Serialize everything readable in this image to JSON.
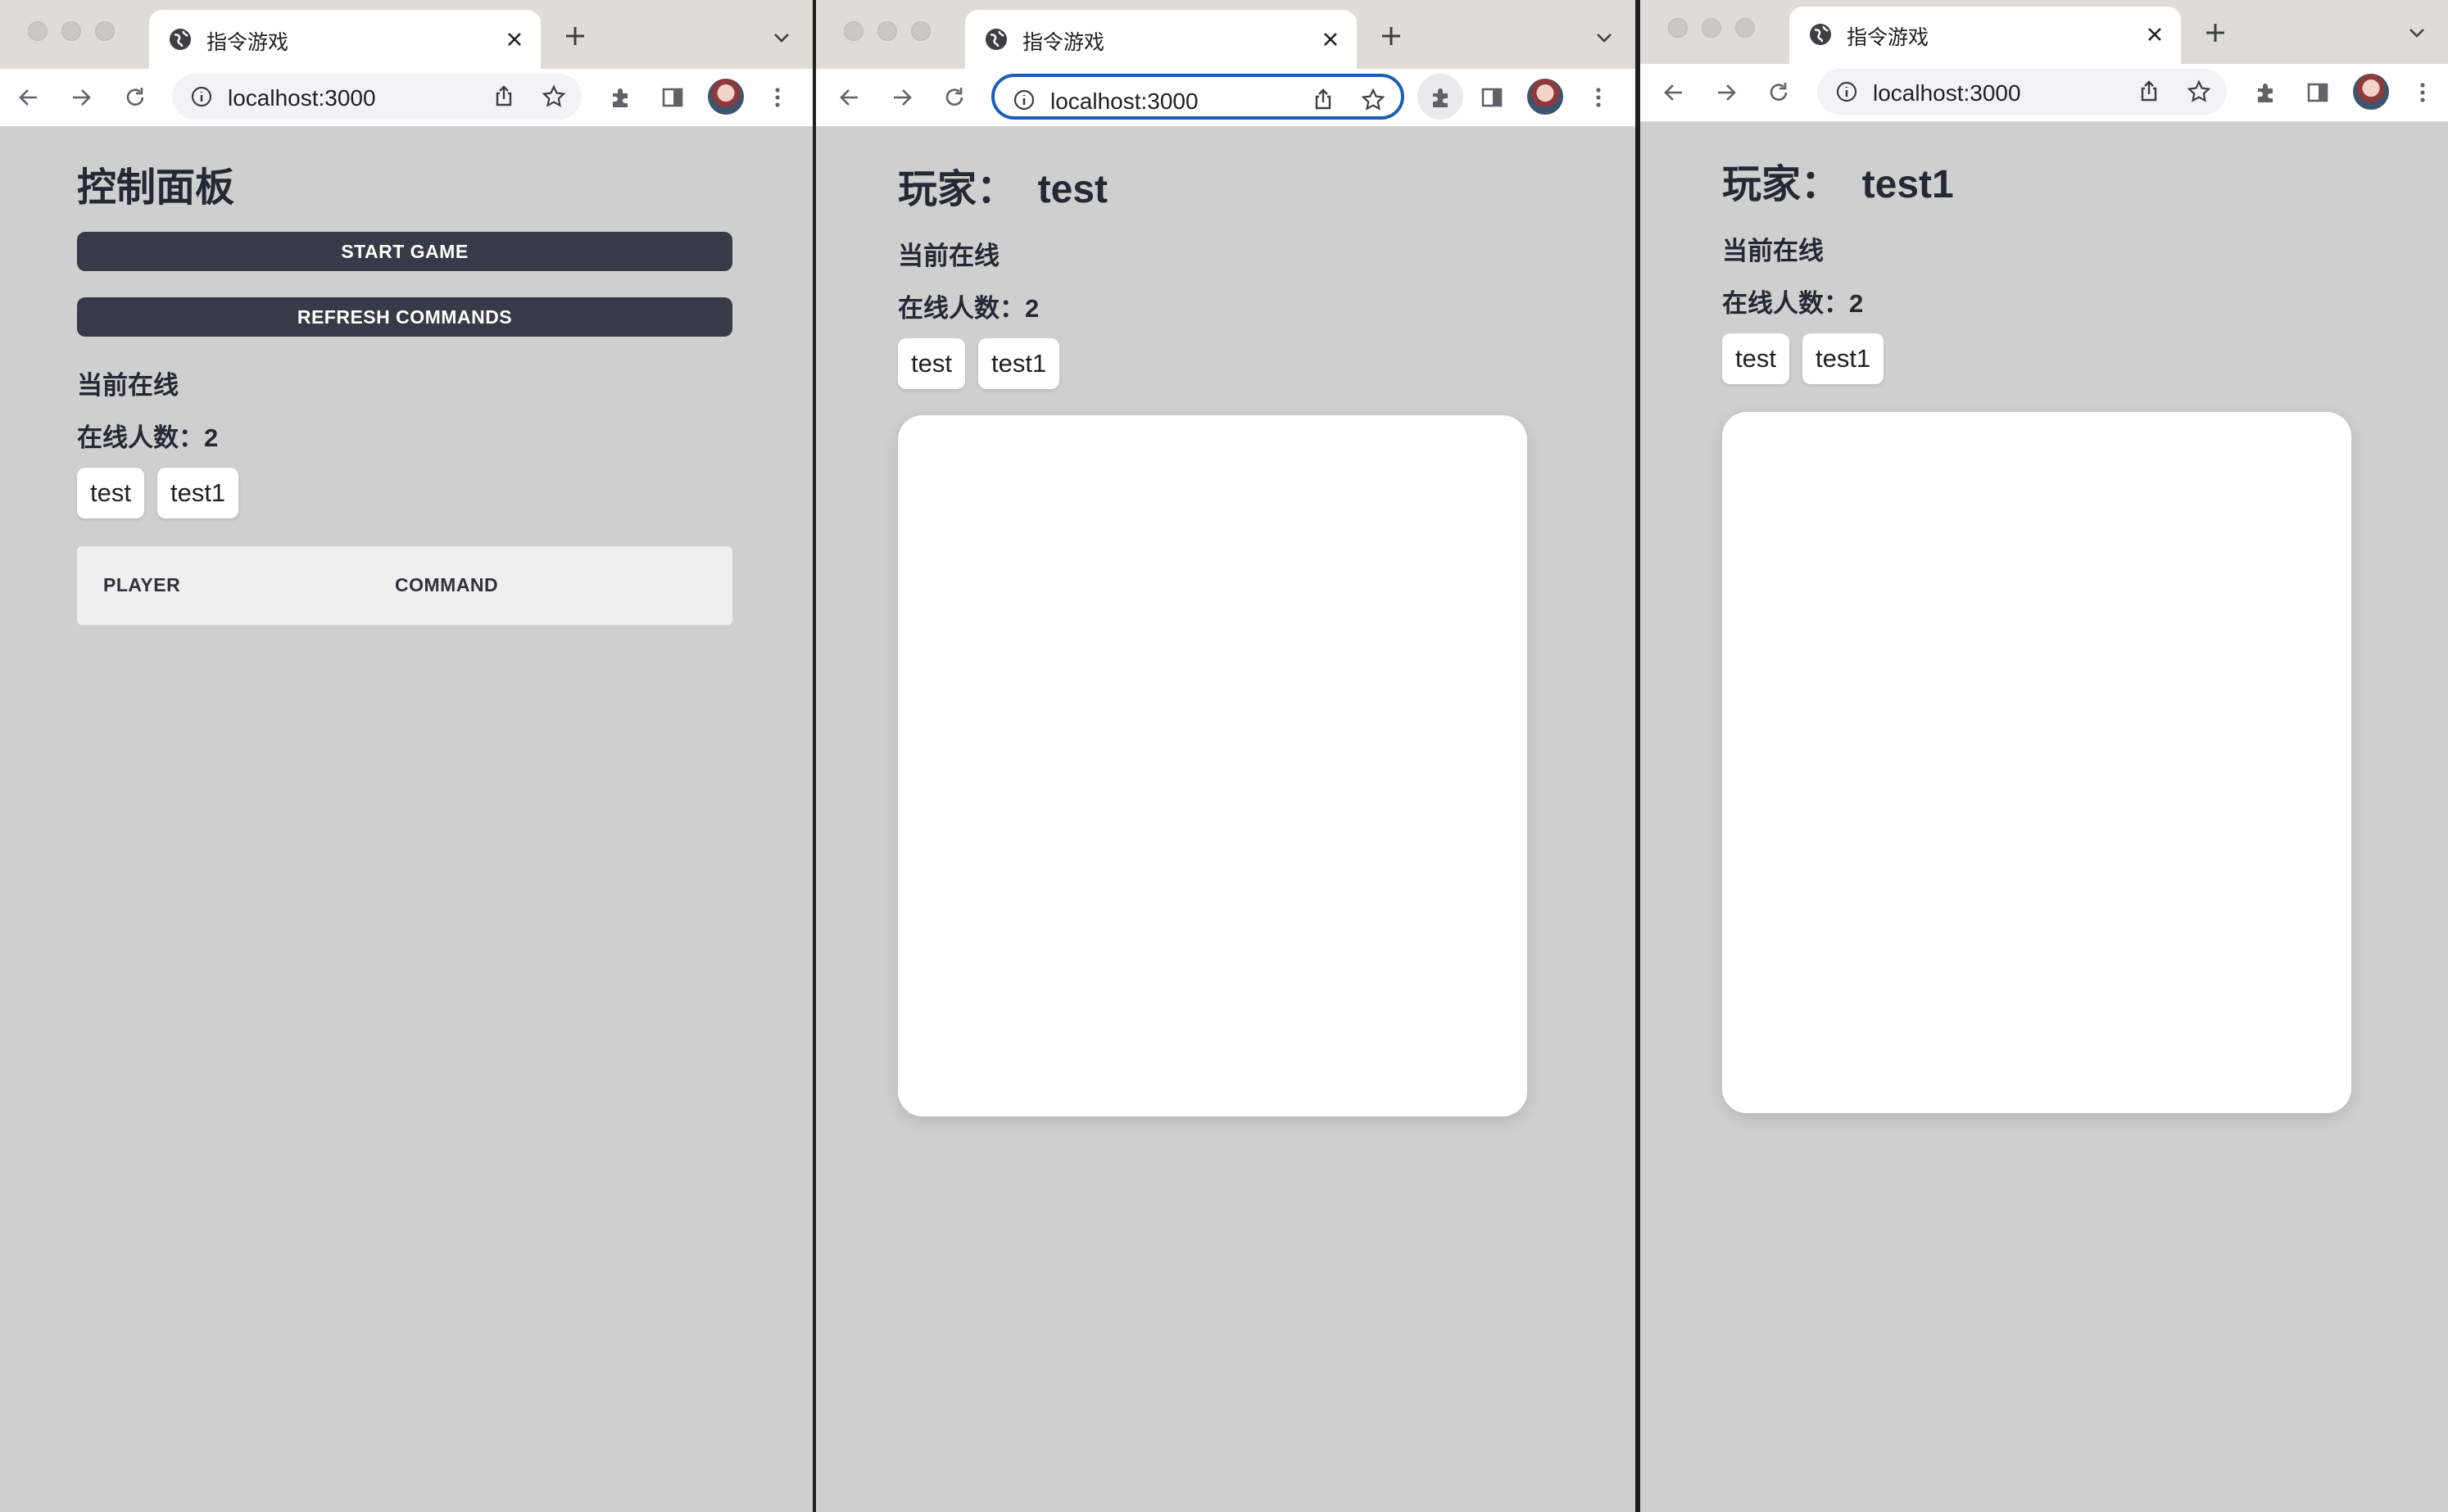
{
  "colors": {
    "dark_button": "#363b47",
    "page_bg": "#cecfcf",
    "heading": "#232935",
    "focus_ring": "#1a5fb4"
  },
  "browser": {
    "tab_title": "指令游戏",
    "url": "localhost:3000",
    "icons": [
      "back-icon",
      "forward-icon",
      "reload-icon",
      "info-icon",
      "share-icon",
      "star-icon",
      "extensions-icon",
      "side-panel-icon",
      "avatar",
      "more-icon",
      "new-tab-icon",
      "tab-list-icon",
      "close-icon",
      "globe-icon"
    ]
  },
  "control_panel": {
    "title": "控制面板",
    "start_button": "START GAME",
    "refresh_button": "REFRESH COMMANDS",
    "online_heading": "当前在线",
    "online_count_label": "在线人数：2",
    "players": [
      "test",
      "test1"
    ],
    "table": {
      "col_player": "PLAYER",
      "col_command": "COMMAND"
    }
  },
  "player_test": {
    "title": "玩家：  test",
    "online_heading": "当前在线",
    "online_count_label": "在线人数：2",
    "players": [
      "test",
      "test1"
    ]
  },
  "player_test1": {
    "title": "玩家：  test1",
    "online_heading": "当前在线",
    "online_count_label": "在线人数：2",
    "players": [
      "test",
      "test1"
    ]
  }
}
